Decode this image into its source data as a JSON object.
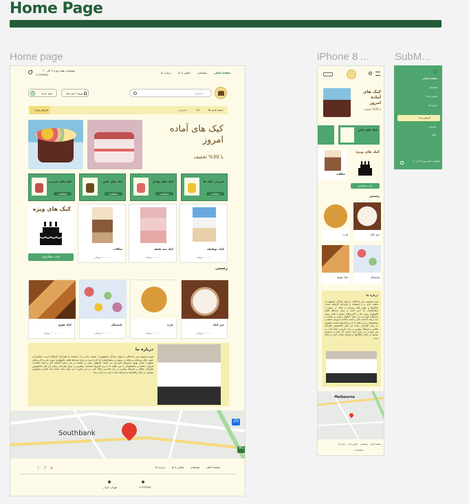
{
  "page": {
    "title": "Home Page"
  },
  "frames": {
    "desktop_label": "Home page",
    "mobile_label": "iPhone 8 ...",
    "submenu_label": "SubM..."
  },
  "desktop": {
    "top": {
      "phone": "پشتیبانی همه روزه ۸ الی ۲۰",
      "phone_number": "۰۲۱۲۲۳۴۵۶",
      "nav": [
        "صفحه اصلی",
        "پشتیبانی",
        "تماس با ما",
        "درباره ما"
      ],
      "search_placeholder": "جستجو...",
      "login_label": "ورود / ثبت نام",
      "cart_label": "سبد خرید",
      "cart_count": "0",
      "categories_label": "دسته بندی ها",
      "breadcrumb": [
        "کیک",
        "شیرینی"
      ],
      "shop_label": "فروش ویژه"
    },
    "hero": {
      "headline_line1": "کیک های آماده",
      "headline_line2": "امروز",
      "discount": "با 30% تخفیف"
    },
    "categories": [
      {
        "name": "شیرینی کیک ها",
        "btn": "مشاهده"
      },
      {
        "name": "کیک های تولدی",
        "btn": "مشاهده"
      },
      {
        "name": "کیک های خاص",
        "btn": "مشاهده"
      },
      {
        "name": "کیک های شیرینی",
        "btn": "مشاهده"
      }
    ],
    "special": {
      "title": "کیک های ویژه",
      "order_btn": "ثبت سفارش",
      "items": [
        {
          "name": "کیک دوطبقه",
          "price": "۱۰۰,۰۰۰ تومان"
        },
        {
          "name": "کیک سه طبقه",
          "price": "۱۰۰,۰۰۰ تومان"
        },
        {
          "name": "شکلات",
          "price": "۱۰۰,۰۰۰ تومان"
        }
      ]
    },
    "pastry": {
      "title": "رسپی",
      "items": [
        {
          "name": "چیز کیک",
          "price": "۱۰۰,۰۰۰ تومان"
        },
        {
          "name": "تارت",
          "price": "۱۰۰,۰۰۰ تومان"
        },
        {
          "name": "پاپسیکل",
          "price": "۱۰۰,۰۰۰ تومان"
        },
        {
          "name": "کیک هویج",
          "price": "۱۰۰,۰۰۰ تومان"
        }
      ]
    },
    "about": {
      "title": "درباره ما",
      "body": "لورم ایپسوم متن ساختگی با تولید سادگی نامفهوم از صنعت چاپ و با استفاده از طراحان گرافیک است. چاپگرها و متون بلکه روزنامه و مجله در ستون و سطرآنچنان که لازم است و برای شرایط فعلی تکنولوژی مورد نیاز و کاربردهای متنوع با هدف بهبود ابزارهای کاربردی می باشد. کتابهای زیادی در شصت و سه درصد گذشته حال و آینده شناخت فراوان جامعه و متخصصان را می طلبد تا با نرم افزارها شناخت بیشتری را برای طراحان رایانه ای علی الخصوص طراحان خلاقی و فرهنگ پیشرو در زبان فارسی ایجاد کرد. در این صورت می توان امید داشت که تمام و دشواری موجود در ارائه راهکارها و شرایط سخت تایپ به پایان رسد."
    },
    "map": {
      "label": "Southbank",
      "badge": "20",
      "road": "M1"
    },
    "footer": {
      "nav": [
        "صفحه اصلی",
        "پشتیبانی",
        "تماس با ما",
        "درباره ما"
      ],
      "phone": "۰۲۱۲۲۳۴۵۶",
      "address": "تهران، ایران"
    }
  },
  "mobile": {
    "hero_title_l1": "کیک های آماده",
    "hero_title_l2": "امروز",
    "hero_discount": "با 30% تخفیف",
    "cat1": "کیک های خاص",
    "cat2": "کیک های تولدی",
    "special_title": "کیک های ویژه",
    "order_btn": "ثبت سفارش",
    "pastry_title": "رسپی",
    "about_title": "درباره ما",
    "map_label": "Melbourne",
    "items": [
      {
        "name": "شکلات",
        "price": "۱۰۰,۰۰۰ تومان"
      },
      {
        "name": "چیز کیک",
        "price": "۱۰۰,۰۰۰ تومان"
      },
      {
        "name": "تارت",
        "price": "۱۰۰,۰۰۰ تومان"
      },
      {
        "name": "پاپسیکل",
        "price": "۱۰۰,۰۰۰ تومان"
      },
      {
        "name": "کیک هویج",
        "price": "۱۰۰,۰۰۰ تومان"
      }
    ]
  },
  "submenu": {
    "items": [
      "صفحه اصلی",
      "پشتیبانی",
      "تماس با ما",
      "درباره ما"
    ],
    "shop_label": "فروش ویژه",
    "extra": [
      "شیرینی",
      "کیک"
    ],
    "phone": "پشتیبانی همه روزه ۸ الی ۲۰"
  },
  "colors": {
    "green": "#4fa56e",
    "dark_green": "#255a39",
    "cream": "#fdfbe7",
    "yellow": "#f6eeb0"
  }
}
